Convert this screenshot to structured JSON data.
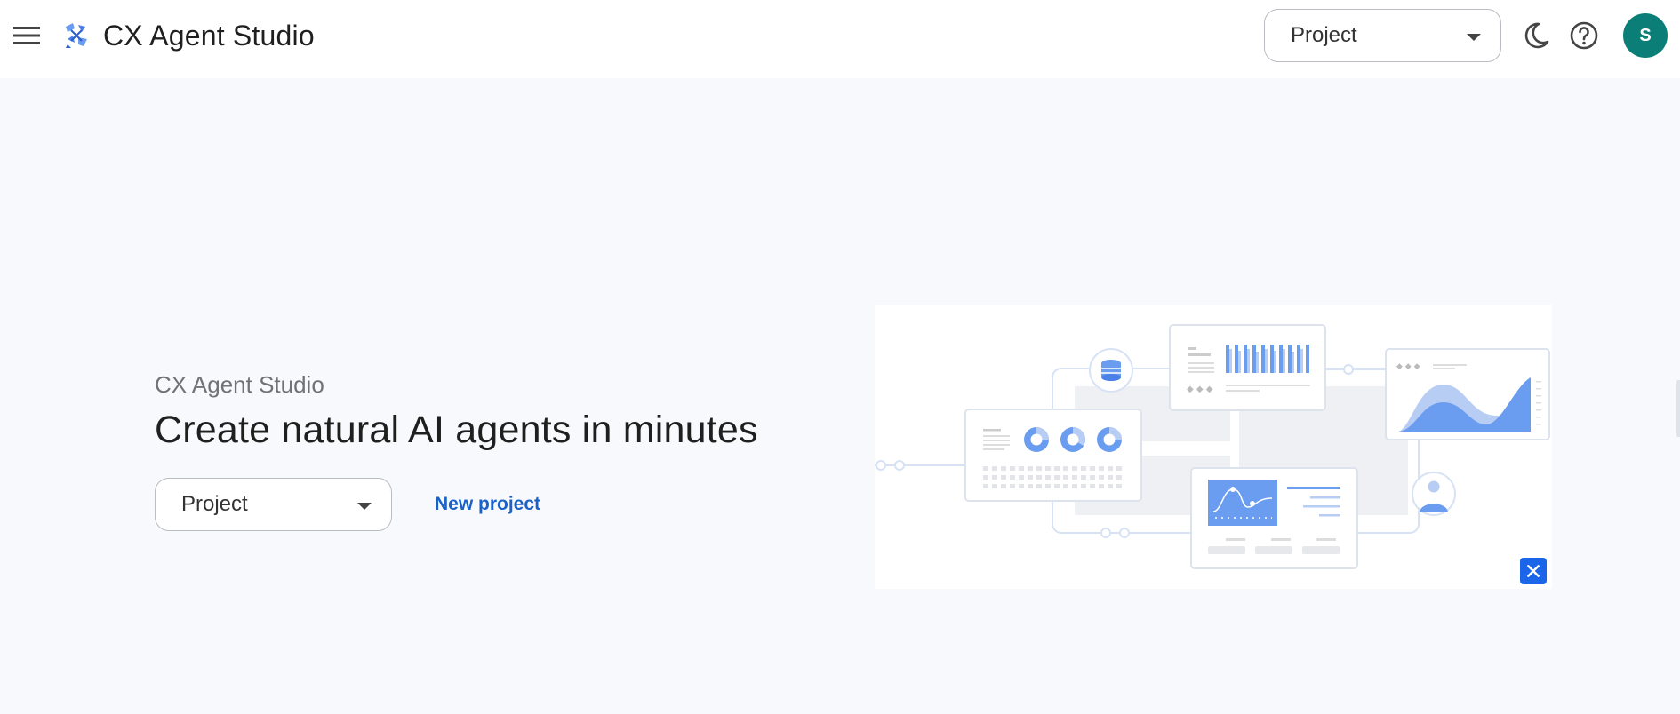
{
  "app": {
    "title": "CX Agent Studio",
    "logo_icon": "cx-agent-studio-logo-icon",
    "menu_icon": "hamburger-menu-icon"
  },
  "header": {
    "project_select": {
      "value": "Project"
    },
    "theme_icon": "dark-mode-moon-icon",
    "help_icon": "help-circle-icon",
    "avatar_initial": "S",
    "avatar_color": "#0b7f77"
  },
  "hero": {
    "eyebrow": "CX Agent Studio",
    "title": "Create natural AI agents in minutes",
    "project_select": {
      "value": "Project"
    },
    "new_project_label": "New project"
  },
  "colors": {
    "accent_blue": "#1a62c7",
    "chart_blue": "#6a9cf0",
    "background": "#f8f9fc"
  }
}
